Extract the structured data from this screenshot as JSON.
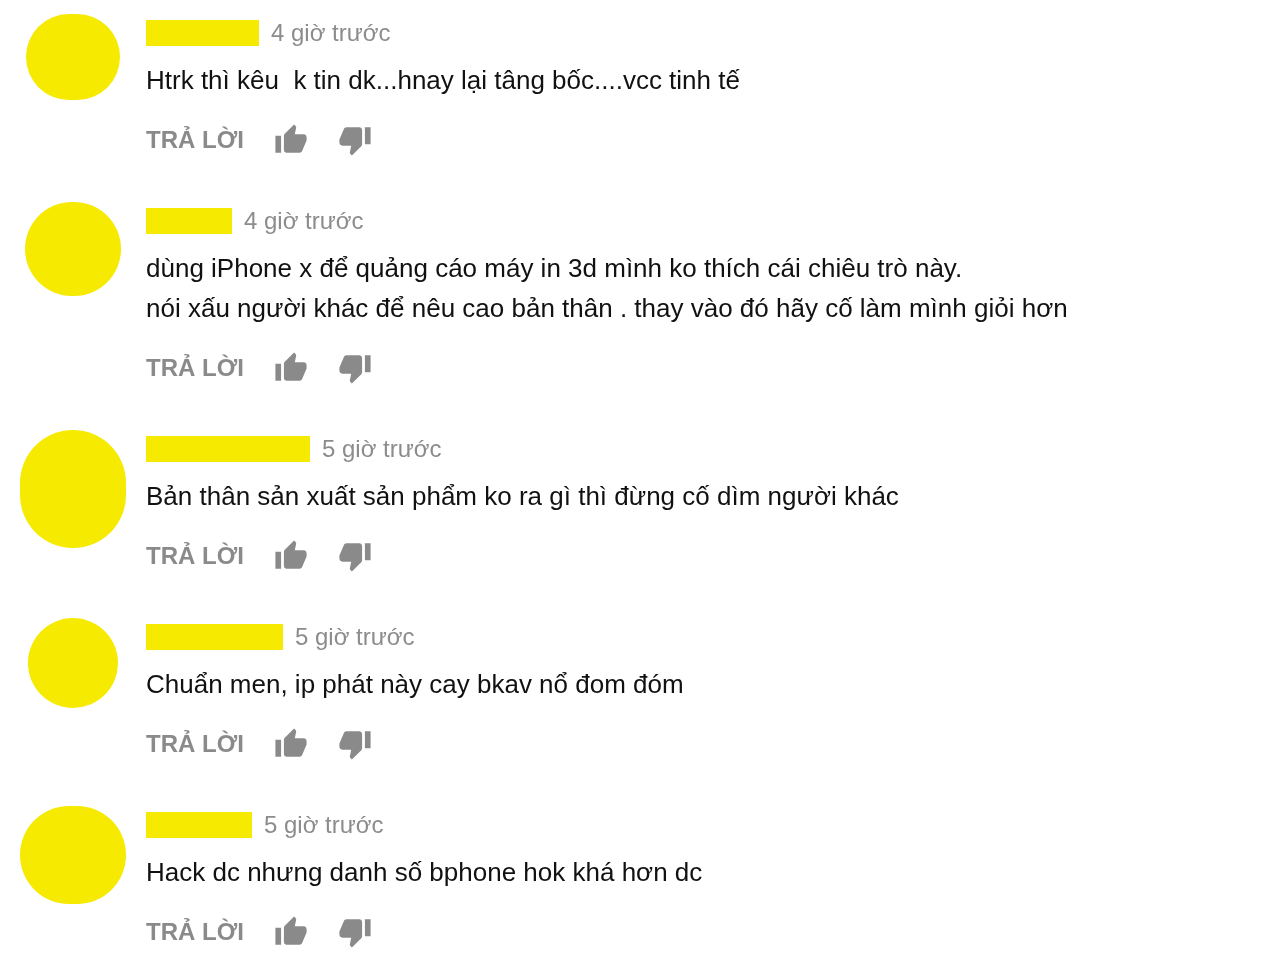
{
  "comments": [
    {
      "time": "4 giờ trước",
      "lines": [
        "Htrk thì kêu  k tin dk...hnay lại tâng bốc....vcc tinh tế"
      ],
      "reply": "TRẢ LỜI"
    },
    {
      "time": "4 giờ trước",
      "lines": [
        "dùng iPhone x để quảng cáo máy in 3d mình ko thích cái chiêu trò này.",
        "nói xấu người khác để nêu cao bản thân . thay vào đó hãy cố làm mình giỏi hơn"
      ],
      "reply": "TRẢ LỜI"
    },
    {
      "time": "5 giờ trước",
      "lines": [
        "Bản thân sản xuất sản phẩm ko ra gì thì đừng cố dìm người khác"
      ],
      "reply": "TRẢ LỜI"
    },
    {
      "time": "5 giờ trước",
      "lines": [
        "Chuẩn men, ip phát này cay bkav nổ đom đóm"
      ],
      "reply": "TRẢ LỜI"
    },
    {
      "time": "5 giờ trước",
      "lines": [
        "Hack dc nhưng danh số bphone hok khá hơn dc"
      ],
      "reply": "TRẢ LỜI"
    }
  ]
}
